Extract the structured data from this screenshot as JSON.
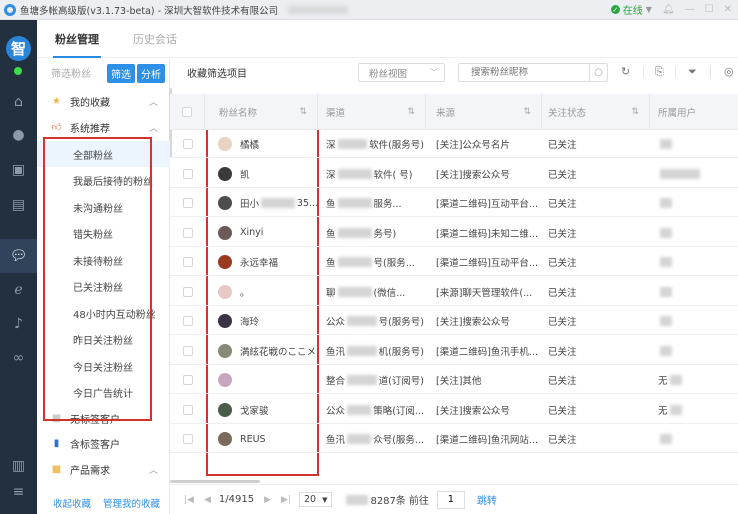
{
  "window": {
    "title": "鱼塘多帐高级版(v3.1.73-beta) - 深圳大智软件技术有限公司",
    "status_label": "在线",
    "status_color": "#28a745"
  },
  "leftbar": {
    "avatar_char": "智",
    "icons": [
      "home-icon",
      "chat-icon",
      "contacts-icon",
      "document-icon",
      "wechat-icon",
      "ie-browser-icon",
      "tiktok-icon",
      "mini-program-icon",
      "dashboard-icon",
      "menu-icon"
    ]
  },
  "tabs": [
    {
      "label": "粉丝管理",
      "active": true
    },
    {
      "label": "历史会话",
      "active": false
    }
  ],
  "sidebar": {
    "filter_label": "筛选粉丝",
    "filter_button": "筛选",
    "analyze_button": "分析",
    "groups": {
      "favorites": "我的收藏",
      "recommend": "系统推荐",
      "untagged": "无标签客户",
      "tagged": "含标签客户",
      "product": "产品需求"
    },
    "items": [
      "全部粉丝",
      "我最后接待的粉丝",
      "未沟通粉丝",
      "错失粉丝",
      "未接待粉丝",
      "已关注粉丝",
      "48小时内互动粉丝",
      "昨日关注粉丝",
      "今日关注粉丝",
      "今日广告统计"
    ],
    "footer": {
      "collapse": "收起收藏",
      "manage": "管理我的收藏"
    }
  },
  "main": {
    "toolbar_title": "收藏筛选项目",
    "view_select": "粉丝视图",
    "search_placeholder": "搜索粉丝昵称",
    "columns": [
      "粉丝名称",
      "渠道",
      "来源",
      "关注状态",
      "所属用户"
    ],
    "rows": [
      {
        "name": "橘橘",
        "channel_a": "深",
        "channel_b": "软件(服务号)",
        "source": "[关注]公众号名片",
        "status": "已关注",
        "avatar": "#e9d2c0"
      },
      {
        "name": "凯",
        "channel_a": "深",
        "channel_b": "软件(  号)",
        "source": "[关注]搜索公众号",
        "status": "已关注",
        "avatar": "#3a3a3a"
      },
      {
        "name": "田小",
        "name_suffix": "35...",
        "channel_a": "鱼",
        "channel_b": "服务...",
        "source": "[渠道二维码]互动平台...",
        "status": "已关注",
        "avatar": "#4d4d4d"
      },
      {
        "name": "Xinyi",
        "channel_a": "鱼",
        "channel_b": "务号)",
        "source": "[渠道二维码]未知二维...",
        "status": "已关注",
        "avatar": "#6b5a55"
      },
      {
        "name": "永远幸福",
        "channel_a": "鱼",
        "channel_b": "号(服务...",
        "source": "[渠道二维码]互动平台...",
        "status": "已关注",
        "avatar": "#9b3a1e"
      },
      {
        "name": "。",
        "channel_a": "聊",
        "channel_b": "(微信...",
        "source": "[来源]聊天管理软件(...",
        "status": "已关注",
        "avatar": "#e8c9c6"
      },
      {
        "name": "海玲",
        "channel_a": "公众",
        "channel_b": "号(服务号)",
        "source": "[关注]搜索公众号",
        "status": "已关注",
        "avatar": "#3d3346"
      },
      {
        "name": "満絃花戦のここメ",
        "channel_a": "鱼汛",
        "channel_b": "机(服务号)",
        "source": "[渠道二维码]鱼汛手机...",
        "status": "已关注",
        "avatar": "#8a8a78"
      },
      {
        "name": "",
        "channel_a": "整合",
        "channel_b": "道(订阅号)",
        "source": "[关注]其他",
        "status": "已关注",
        "avatar": "#c8a6c0",
        "owner_hint": "无"
      },
      {
        "name": "戈家骏",
        "channel_a": "公众",
        "channel_b": "策略(订阅...",
        "source": "[关注]搜索公众号",
        "status": "已关注",
        "avatar": "#4a5c4a",
        "owner_hint": "无"
      },
      {
        "name": "REUS",
        "channel_a": "鱼汛",
        "channel_b": "众号(服务...",
        "source": "[渠道二维码]鱼汛网站...",
        "status": "已关注",
        "avatar": "#7a6a5a"
      }
    ],
    "pager": {
      "page": "1/4915",
      "page_size": "20",
      "total": "8287条",
      "goto_label": "前往",
      "goto_value": "1",
      "jump": "跳转"
    }
  }
}
